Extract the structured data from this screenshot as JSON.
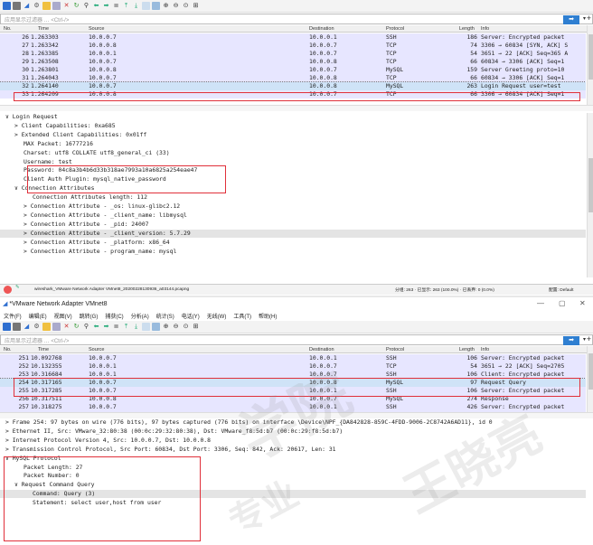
{
  "top": {
    "filter": {
      "placeholder": "应用显示过滤器 … <Ctrl-/>"
    },
    "columns": {
      "no": "No.",
      "time": "Time",
      "source": "Source",
      "destination": "Destination",
      "protocol": "Protocol",
      "length": "Length",
      "info": "Info"
    },
    "packets": [
      {
        "no": "26",
        "time": "1.263303",
        "src": "10.0.0.7",
        "dst": "10.0.0.1",
        "proto": "SSH",
        "len": "186",
        "info": "Server: Encrypted packet"
      },
      {
        "no": "27",
        "time": "1.263342",
        "src": "10.0.0.8",
        "dst": "10.0.0.7",
        "proto": "TCP",
        "len": "74",
        "info": "3306 → 60834 [SYN, ACK] S"
      },
      {
        "no": "28",
        "time": "1.263385",
        "src": "10.0.0.1",
        "dst": "10.0.0.7",
        "proto": "TCP",
        "len": "54",
        "info": "3651 → 22 [ACK] Seq=365 A"
      },
      {
        "no": "29",
        "time": "1.263508",
        "src": "10.0.0.7",
        "dst": "10.0.0.8",
        "proto": "TCP",
        "len": "66",
        "info": "60834 → 3306 [ACK] Seq=1"
      },
      {
        "no": "30",
        "time": "1.263801",
        "src": "10.0.0.8",
        "dst": "10.0.0.7",
        "proto": "MySQL",
        "len": "159",
        "info": "Server Greeting proto=10"
      },
      {
        "no": "31",
        "time": "1.264043",
        "src": "10.0.0.7",
        "dst": "10.0.0.8",
        "proto": "TCP",
        "len": "66",
        "info": "60834 → 3306 [ACK] Seq=1"
      },
      {
        "no": "32",
        "time": "1.264140",
        "src": "10.0.0.7",
        "dst": "10.0.0.8",
        "proto": "MySQL",
        "len": "263",
        "info": "Login Request user=test"
      },
      {
        "no": "33",
        "time": "1.264209",
        "src": "10.0.0.8",
        "dst": "10.0.0.7",
        "proto": "TCP",
        "len": "66",
        "info": "3306 → 60834 [ACK] Seq=1"
      }
    ],
    "details": [
      {
        "t": "∨ Login Request",
        "i": 0
      },
      {
        "t": "> Client Capabilities: 0xa685",
        "i": 1
      },
      {
        "t": "> Extended Client Capabilities: 0x01ff",
        "i": 1
      },
      {
        "t": "MAX Packet: 16777216",
        "i": 2
      },
      {
        "t": "Charset: utf8 COLLATE utf8_general_ci (33)",
        "i": 2
      },
      {
        "t": "Username: test",
        "i": 2
      },
      {
        "t": "Password: 04c8a3b4b6d33b318ae7993a10a6825a254eae47",
        "i": 2
      },
      {
        "t": "Client Auth Plugin: mysql_native_password",
        "i": 2
      },
      {
        "t": "∨ Connection Attributes",
        "i": 1
      },
      {
        "t": "Connection Attributes length: 112",
        "i": 3
      },
      {
        "t": "> Connection Attribute - _os: linux-glibc2.12",
        "i": 2
      },
      {
        "t": "> Connection Attribute - _client_name: libmysql",
        "i": 2
      },
      {
        "t": "> Connection Attribute - _pid: 24007",
        "i": 2
      },
      {
        "t": "> Connection Attribute - _client_version: 5.7.29",
        "i": 2
      },
      {
        "t": "> Connection Attribute - _platform: x86_64",
        "i": 2
      },
      {
        "t": "> Connection Attribute - program_name: mysql",
        "i": 2
      }
    ],
    "status": {
      "file": "wireshark_VMware Network Adapter VMnet8_20200228130936_a03144.pcapng",
      "stats": "分组: 263 · 已显示: 263 (100.0%) · 已丢弃: 0 (0.0%)",
      "profile": "配置: Default"
    }
  },
  "bottom": {
    "title": "*VMware Network Adapter VMnet8",
    "menu": [
      "文件(F)",
      "编辑(E)",
      "视图(V)",
      "跳转(G)",
      "捕获(C)",
      "分析(A)",
      "统计(S)",
      "电话(Y)",
      "无线(W)",
      "工具(T)",
      "帮助(H)"
    ],
    "filter": {
      "placeholder": "应用显示过滤器 … <Ctrl-/>"
    },
    "columns": {
      "no": "No.",
      "time": "Time",
      "source": "Source",
      "destination": "Destination",
      "protocol": "Protocol",
      "length": "Length",
      "info": "Info"
    },
    "packets": [
      {
        "no": "251",
        "time": "10.092768",
        "src": "10.0.0.7",
        "dst": "10.0.0.1",
        "proto": "SSH",
        "len": "106",
        "info": "Server: Encrypted packet"
      },
      {
        "no": "252",
        "time": "10.132355",
        "src": "10.0.0.1",
        "dst": "10.0.0.7",
        "proto": "TCP",
        "len": "54",
        "info": "3651 → 22 [ACK] Seq=2705"
      },
      {
        "no": "253",
        "time": "10.316684",
        "src": "10.0.0.1",
        "dst": "10.0.0.7",
        "proto": "SSH",
        "len": "106",
        "info": "Client: Encrypted packet"
      },
      {
        "no": "254",
        "time": "10.317165",
        "src": "10.0.0.7",
        "dst": "10.0.0.8",
        "proto": "MySQL",
        "len": "97",
        "info": "Request Query"
      },
      {
        "no": "255",
        "time": "10.317285",
        "src": "10.0.0.7",
        "dst": "10.0.0.1",
        "proto": "SSH",
        "len": "106",
        "info": "Server: Encrypted packet"
      },
      {
        "no": "256",
        "time": "10.317511",
        "src": "10.0.0.8",
        "dst": "10.0.0.7",
        "proto": "MySQL",
        "len": "274",
        "info": "Response"
      },
      {
        "no": "257",
        "time": "10.318275",
        "src": "10.0.0.7",
        "dst": "10.0.0.1",
        "proto": "SSH",
        "len": "426",
        "info": "Server: Encrypted packet"
      },
      {
        "no": "258",
        "time": "10.318331",
        "src": "10.0.0.1",
        "dst": "10.0.0.7",
        "proto": "TCP",
        "len": "54",
        "info": "3651 → 22 [ACK] Seq=2757"
      }
    ],
    "details": [
      {
        "t": "> Frame 254: 97 bytes on wire (776 bits), 97 bytes captured (776 bits) on interface \\Device\\NPF_{DA842828-859C-4FDD-9006-2C8742A6AD11}, id 0",
        "i": 0
      },
      {
        "t": "> Ethernet II, Src: VMware_32:80:38 (00:0c:29:32:80:38), Dst: VMware_f8:5d:b7 (00:0c:29:f8:5d:b7)",
        "i": 0
      },
      {
        "t": "> Internet Protocol Version 4, Src: 10.0.0.7, Dst: 10.0.0.8",
        "i": 0
      },
      {
        "t": "> Transmission Control Protocol, Src Port: 60834, Dst Port: 3306, Seq: 842, Ack: 20617, Len: 31",
        "i": 0
      },
      {
        "t": "∨ MySQL Protocol",
        "i": 0
      },
      {
        "t": "Packet Length: 27",
        "i": 2
      },
      {
        "t": "Packet Number: 0",
        "i": 2
      },
      {
        "t": "∨ Request Command Query",
        "i": 1
      },
      {
        "t": "Command: Query (3)",
        "i": 3
      },
      {
        "t": "Statement: select user,host from user",
        "i": 3
      }
    ],
    "watermark": [
      "学院",
      "王晓亮",
      "专业"
    ]
  },
  "colors": {
    "selected": "#cfe3f7",
    "hl_red": "#e0303a",
    "ssh_row": "#e7e6ff",
    "tcp_row": "#e7e6ff",
    "mysql_row": "#e7e6ff"
  }
}
